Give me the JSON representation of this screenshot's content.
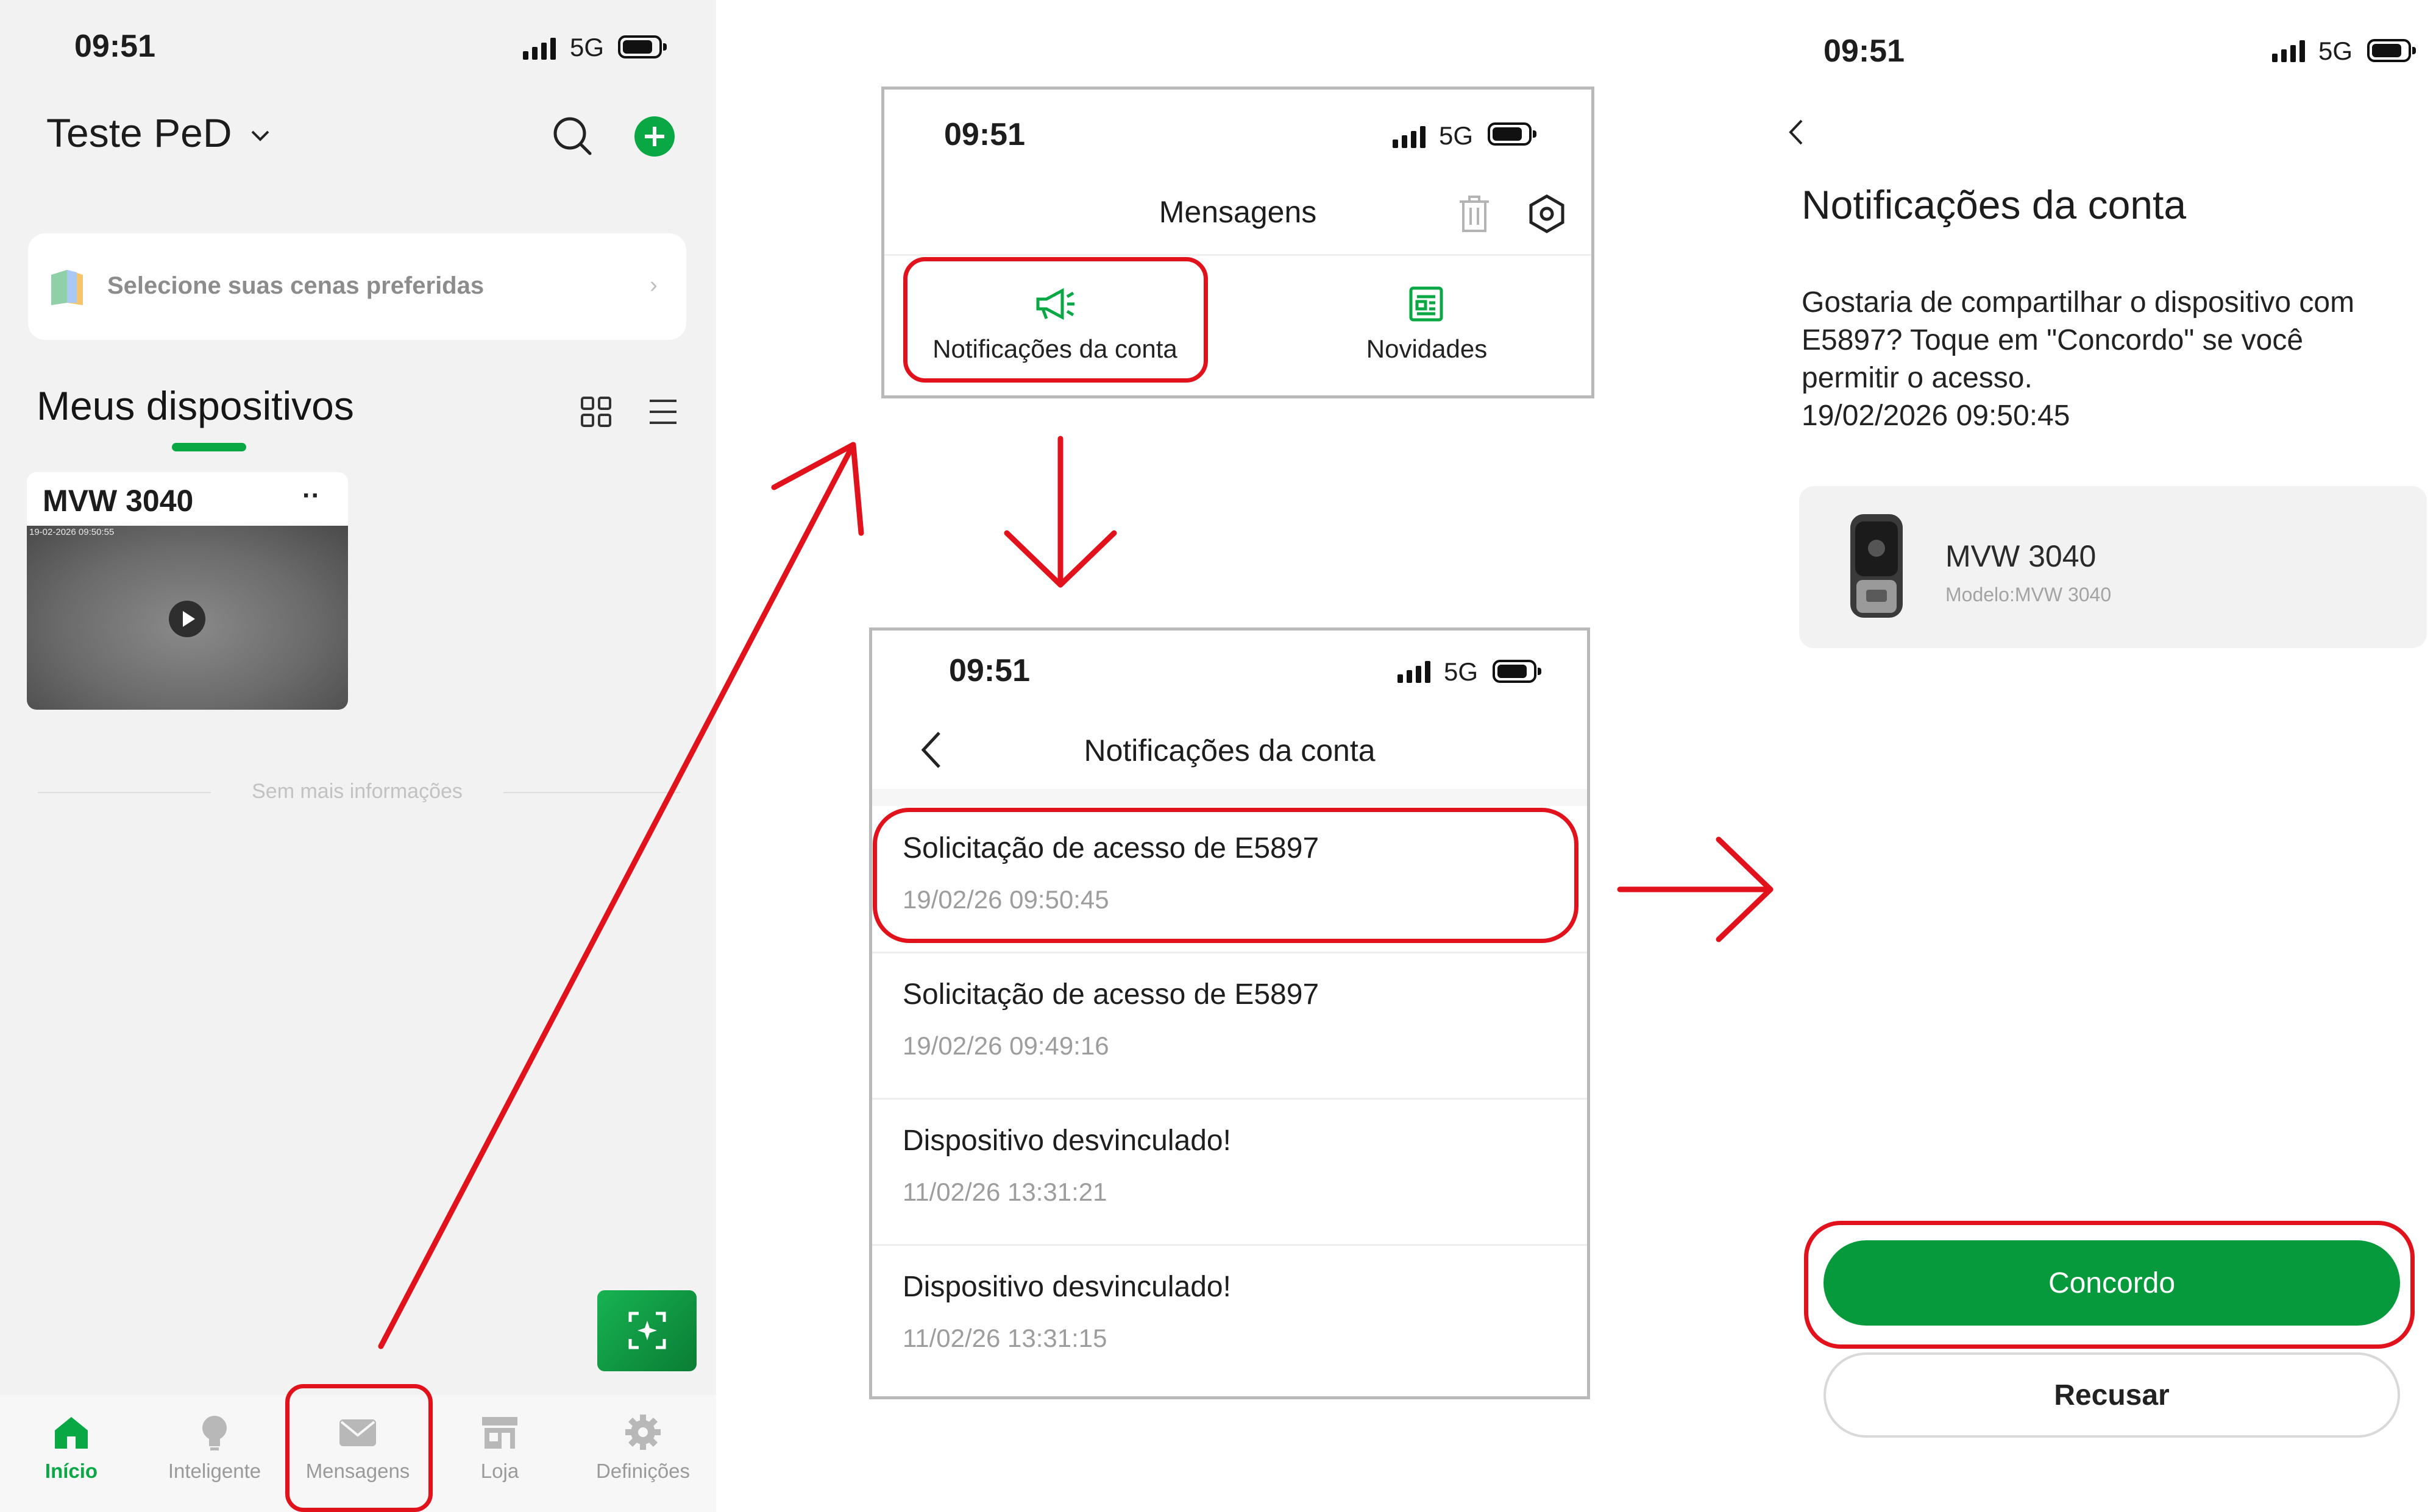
{
  "colors": {
    "accent": "#079a3c",
    "annotation_red": "#e1121b"
  },
  "status_bar": {
    "time": "09:51",
    "network": "5G"
  },
  "home": {
    "workspace": "Teste PeD",
    "scene_banner": "Selecione suas cenas preferidas",
    "section_title": "Meus dispositivos",
    "device": {
      "name": "MVW 3040",
      "timestamp": "19-02-2026 09:50:55",
      "menu": "··"
    },
    "footer_note": "Sem mais informações",
    "nav": [
      {
        "label": "Início",
        "icon": "home-icon",
        "active": true
      },
      {
        "label": "Inteligente",
        "icon": "lightbulb-icon",
        "active": false
      },
      {
        "label": "Mensagens",
        "icon": "mail-icon",
        "active": false
      },
      {
        "label": "Loja",
        "icon": "store-icon",
        "active": false
      },
      {
        "label": "Definições",
        "icon": "gear-icon",
        "active": false
      }
    ]
  },
  "messages": {
    "title": "Mensagens",
    "tabs": [
      {
        "label": "Notificações da conta",
        "icon": "megaphone-icon"
      },
      {
        "label": "Novidades",
        "icon": "newspaper-icon"
      }
    ]
  },
  "notifications": {
    "title": "Notificações da conta",
    "items": [
      {
        "title": "Solicitação de acesso de E5897",
        "date": "19/02/26 09:50:45"
      },
      {
        "title": "Solicitação de acesso de E5897",
        "date": "19/02/26 09:49:16"
      },
      {
        "title": "Dispositivo desvinculado!",
        "date": "11/02/26 13:31:21"
      },
      {
        "title": "Dispositivo desvinculado!",
        "date": "11/02/26 13:31:15"
      }
    ]
  },
  "detail": {
    "title": "Notificações da conta",
    "message_lines": [
      "Gostaria de compartilhar o dispositivo com",
      "E5897? Toque em \"Concordo\" se você",
      "permitir o acesso.",
      "19/02/2026 09:50:45"
    ],
    "device_name": "MVW 3040",
    "device_model": "Modelo:MVW 3040",
    "accept": "Concordo",
    "reject": "Recusar"
  }
}
